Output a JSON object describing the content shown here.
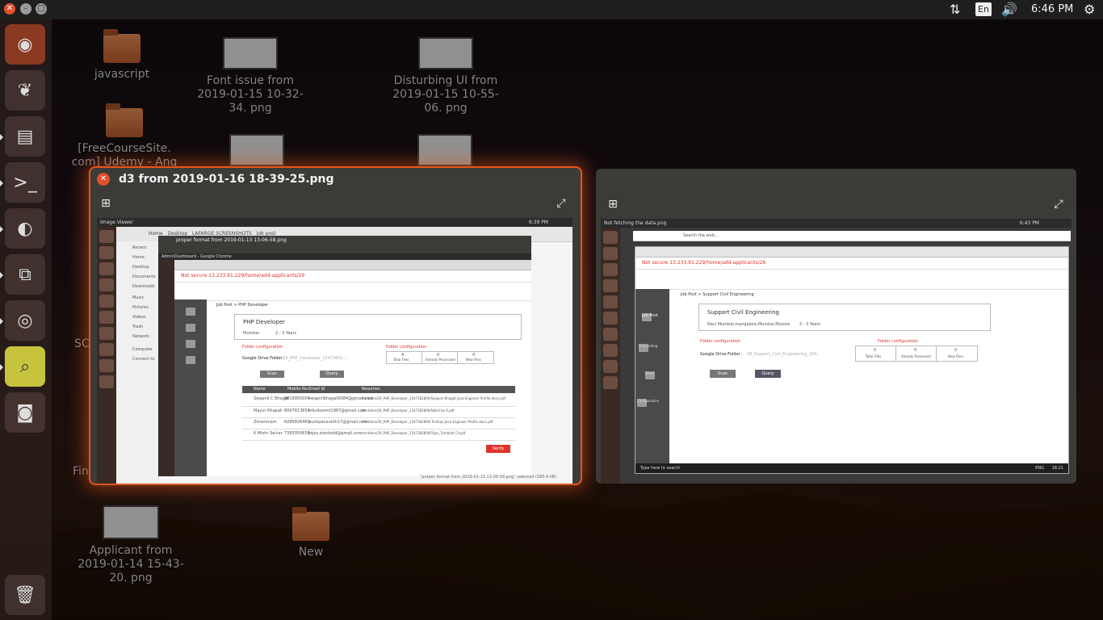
{
  "top_panel": {
    "network_icon": "transfer-arrows-icon",
    "lang": "En",
    "volume_icon": "speaker-icon",
    "time": "6:46 PM",
    "power_icon": "gear-icon"
  },
  "launcher": [
    {
      "name": "ubuntu-dash",
      "icon": "ubuntu-logo-icon"
    },
    {
      "name": "spring-ide",
      "icon": "leaf-icon"
    },
    {
      "name": "files",
      "icon": "file-cabinet-icon"
    },
    {
      "name": "terminal",
      "icon": "terminal-icon"
    },
    {
      "name": "firefox",
      "icon": "firefox-icon"
    },
    {
      "name": "vscode",
      "icon": "vscode-icon"
    },
    {
      "name": "chrome",
      "icon": "chrome-icon"
    },
    {
      "name": "image-viewer",
      "icon": "magnifier-icon"
    },
    {
      "name": "screenshot",
      "icon": "camera-icon"
    },
    {
      "name": "trash",
      "icon": "trash-icon"
    }
  ],
  "desktop_icons": [
    {
      "label": "javascript",
      "kind": "folder"
    },
    {
      "label": "Font issue from 2019-01-15 10-32-34. png",
      "kind": "image"
    },
    {
      "label": "Disturbing UI  from 2019-01-15 10-55-06. png",
      "kind": "image"
    },
    {
      "label": "[FreeCourseSite. com] Udemy - Ang",
      "kind": "folder"
    },
    {
      "label": "SC",
      "kind": "partial"
    },
    {
      "label": "Fin",
      "kind": "partial"
    },
    {
      "label": "Applicant from 2019-01-14 15-43-20. png",
      "kind": "image"
    },
    {
      "label": "New",
      "kind": "folder"
    }
  ],
  "window_left": {
    "title": "d3 from 2019-01-16 18-39-25.png",
    "inner_title": "Image Viewer",
    "inner_time": "6:39 PM",
    "breadcrumb": [
      "Home",
      "Desktop",
      "LAFARGE SCREENSHOTS",
      "job post"
    ],
    "sidebar": [
      "Recent",
      "Home",
      "Desktop",
      "Documents",
      "Downloads",
      "Music",
      "Pictures",
      "Videos",
      "Trash",
      "Network",
      "Computer",
      "Connect to"
    ],
    "nested_title": "proper format from 2019-01-13 13-06-58.png",
    "browser_title": "AdminDashboard - Google Chrome",
    "url": "Not secure  13.233.91.229/home/add-applicants/29",
    "page_crumb": "Job Post  >  PHP Developer",
    "job_title": "PHP Developer",
    "job_location": "Mumbai",
    "job_exp": "2 - 3 Years",
    "folder_config_label": "Folder configuration",
    "folder_label": "Google Drive Folder :",
    "folder_value": "29_PHP_Developer_15473602...",
    "scan_btn": "Scan",
    "query_btn": "Query",
    "stats": [
      {
        "v": "4",
        "l": "Total Files"
      },
      {
        "v": "0",
        "l": "Already Processed"
      },
      {
        "v": "4",
        "l": "New Files"
      }
    ],
    "table_headers": [
      "Name",
      "Mobile No.",
      "Email Id",
      "Resumes"
    ],
    "rows": [
      {
        "name": "Swapnil C Bhagat",
        "mobile": "9619950004",
        "email": "swapnilbhagat0084@gmail.com",
        "resume": "/mnt/dev/29_PHP_Developer_1547362809/Swapnil Bhagat Java Engineer Profile.docx.pdf"
      },
      {
        "name": "Mayur Khapali",
        "mobile": "8007813656",
        "email": "nikulkoomt1997@gmail.com",
        "resume": "/mnt/dev/29_PHP_Developer_1547362809/Nikhil bv-5.pdf"
      },
      {
        "name": "Zimenmam",
        "mobile": "8286826463",
        "email": "pushpanaveth17@gmail.com",
        "resume": "/mnt/dev/29_PHP_Developer_1547362809/ Pushpa Java Engineer Profile.docx.pdf"
      },
      {
        "name": "K Mishr Selvar",
        "mobile": "7385050658",
        "email": "tejas.stanbold@gmail.com",
        "resume": "/mnt/dev/29_PHP_Developer_1547362809/Tejas_Tambold CV.pdf"
      }
    ],
    "verify_btn": "Verify",
    "status_text": "\"proper format from 2019-01-13 13-06-58.png\" selected  (180.4 kB)"
  },
  "window_right": {
    "inner_title": "Not fetching the data.png",
    "inner_time": "6:43 PM",
    "search_placeholder": "Search the web...",
    "url": "Not secure  13.233.91.229/home/add-applicants/28",
    "page_crumb": "Job Post  >  Support Civil Engineering",
    "job_title": "Support Civil Engineering",
    "job_location": "Navi Mumbai,mangalore,Mumbai,Mysore",
    "job_exp": "2 - 3 Years",
    "folder_config_label": "Folder configuration",
    "folder_label": "Google Drive Folder :",
    "folder_value": "28_Support_Civil_Engineering_154...",
    "scan_btn": "Scan",
    "query_btn": "Query",
    "stats": [
      {
        "v": "0",
        "l": "Total Files"
      },
      {
        "v": "0",
        "l": "Already Processed"
      },
      {
        "v": "0",
        "l": "New Files"
      }
    ],
    "side_items": [
      "Job Post",
      "Onboarding",
      "Panel",
      "Configuration"
    ],
    "taskbar_search": "Type here to search",
    "taskbar_time": "18:21",
    "taskbar_lang": "ENG"
  }
}
